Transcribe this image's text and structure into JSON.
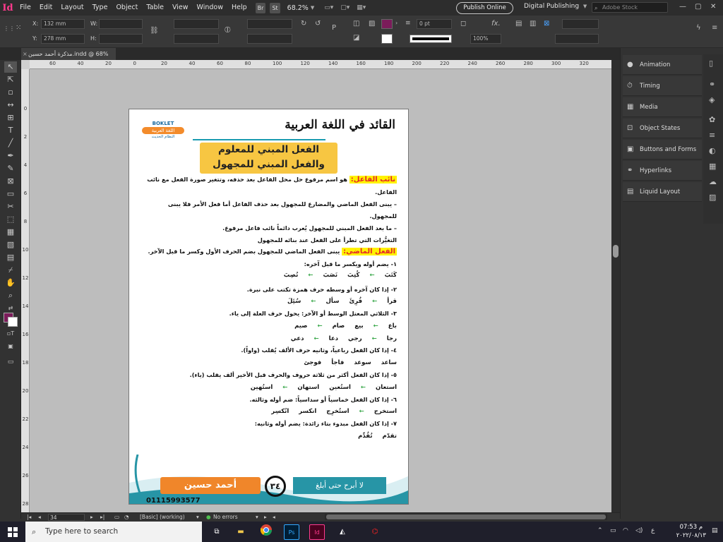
{
  "menubar": {
    "app_logo": "Id",
    "menus": [
      "File",
      "Edit",
      "Layout",
      "Type",
      "Object",
      "Table",
      "View",
      "Window",
      "Help"
    ],
    "bridge": "Br",
    "stock": "St",
    "zoom": "68.2%",
    "publish_online": "Publish Online",
    "workspace": "Digital Publishing",
    "stock_search_placeholder": "Adobe Stock"
  },
  "controlbar": {
    "x_label": "X:",
    "x_value": "132 mm",
    "y_label": "Y:",
    "y_value": "278 mm",
    "w_label": "W:",
    "h_label": "H:",
    "stroke_weight": "0 pt",
    "opacity": "100%"
  },
  "tab": {
    "title": "مذكرة أحمد حسين.indd @ 68%",
    "close": "×"
  },
  "ruler": {
    "h_ticks": [
      "60",
      "40",
      "20",
      "0",
      "20",
      "40",
      "60",
      "80",
      "100",
      "120",
      "140",
      "160",
      "180",
      "200",
      "220",
      "240",
      "260",
      "280",
      "300",
      "320"
    ],
    "v_ticks": [
      "0",
      "2",
      "4",
      "6",
      "8",
      "10",
      "12",
      "14",
      "16",
      "18",
      "20",
      "22",
      "24",
      "26",
      "28"
    ]
  },
  "page": {
    "title": "القائد في اللغة العربية",
    "booklet": {
      "l1": "BOKLET",
      "l2": "اللغة العربية",
      "l3": "النظام الحديث"
    },
    "heading_line1": "الفعل المبني للمعلوم",
    "heading_line2": "والفعل المبني للمجهول",
    "lines": [
      {
        "hl": "نائب الفاعل:",
        "text": " هو اسم مرفوع حل محل الفاعل بعد حذفه، وتتغير صورة الفعل مع نائب"
      },
      {
        "hl": "",
        "text": "الفاعل."
      },
      {
        "hl": "",
        "text": "– يبنى الفعل الماضي والمضارع للمجهول بعد حذف الفاعل أما فعل الأمر فلا يبنى"
      },
      {
        "hl": "",
        "text": "للمجهول."
      },
      {
        "hl": "",
        "text": "– ما بعد الفعل المبني للمجهول يُعرب دائماً نائب فاعل مرفوع."
      },
      {
        "hl": "",
        "text": "التغيُّرات التي تطرأ على الفعل عند بنائه للمجهول"
      },
      {
        "hl": "الفعل الماضي:",
        "text": " يبنى الفعل الماضي للمجهول بضم الحرف الأول وكسر ما قبل الآخر."
      },
      {
        "hl": "",
        "text": "١- يضم أوله ويكسر ما قبل آخره:"
      }
    ],
    "row1": [
      "كَتَبَ",
      "كُتِبَ",
      "نَصَبَ",
      "نُصِبَ"
    ],
    "rule2": "٢- إذا كان آخره أو وسطه حرف همزة تكتب على نبرة.",
    "row2": [
      "قرأ",
      "قُرِئَ",
      "سأل",
      "سُئِلَ"
    ],
    "rule3": "٣- الثلاثي المعتل الوسط أو الآخر: يحول حرف العلة إلى ياء.",
    "row3": [
      "باع",
      "بيع",
      "صام",
      "صيم"
    ],
    "row4": [
      "رجا",
      "رجي",
      "دعا",
      "دعي"
    ],
    "rule4": "٤- إذا كان الفعل رباعياً، وثانيه حرف الألف يُقلب (واواً).",
    "row5": [
      "ساعد",
      "سوعد",
      "فاجأ",
      "فوجئ"
    ],
    "rule5": "٥- إذا كان الفعل أكثر من ثلاثة حروف والحرف قبل الأخير ألف يقلب (ياء).",
    "row6": [
      "استعان",
      "استُعين",
      "استهان",
      "استُهين"
    ],
    "rule6": "٦- إذا كان الفعل خماسياً أو سداسياً: ضم أوله وثالثه.",
    "row7": [
      "استخرج",
      "استُخرِج",
      "انكسر",
      "انُكسِر"
    ],
    "rule7": "٧- إذا كان الفعل مبدوء بتاء زائدة: يضم أوله وثانيه:",
    "row8": [
      "تقدّم",
      "تُقُدِّم"
    ],
    "arrow": "←",
    "footer_name": "أحمد حسين",
    "footer_number": "٣٤",
    "footer_slogan": "لا أبرح حتى أبلغ",
    "footer_phone": "01115993577"
  },
  "panels": [
    "Animation",
    "Timing",
    "Media",
    "Object States",
    "Buttons and Forms",
    "Hyperlinks",
    "Liquid Layout"
  ],
  "statusbar": {
    "page": "34",
    "style": "[Basic] (working)",
    "errors": "No errors"
  },
  "taskbar": {
    "search_placeholder": "Type here to search",
    "time": "07:53 م",
    "date": "٢٠٢٢/٠٨/١٣",
    "lang": "ع"
  }
}
